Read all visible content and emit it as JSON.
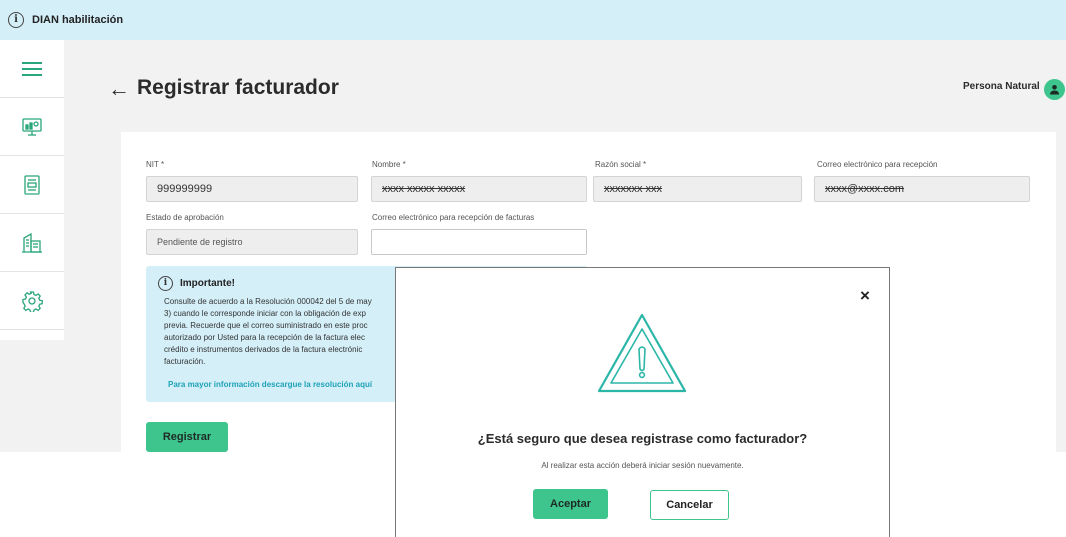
{
  "topbar": {
    "title": "DIAN habilitación",
    "icon": "info-icon"
  },
  "sidebar": {
    "items": [
      {
        "name": "menu-icon"
      },
      {
        "name": "computer-icon"
      },
      {
        "name": "document-icon"
      },
      {
        "name": "building-icon"
      },
      {
        "name": "gear-icon"
      }
    ]
  },
  "header": {
    "back_icon": "←",
    "title": "Registrar facturador",
    "user_type": "Persona Natural"
  },
  "form": {
    "nit": {
      "label": "NIT *",
      "value": "999999999"
    },
    "nombre": {
      "label": "Nombre *",
      "value": "xxxx xxxxx xxxxx"
    },
    "razon_social": {
      "label": "Razón social *",
      "value": "xxxxxxx xxx"
    },
    "correo_recepcion": {
      "label": "Correo electrónico para recepción",
      "value": "xxxx@xxxx.com"
    },
    "estado": {
      "label": "Estado de aprobación",
      "value": "Pendiente de registro"
    },
    "correo_facturas": {
      "label": "Correo electrónico para recepción de facturas",
      "value": ""
    }
  },
  "notice": {
    "title": "Importante!",
    "body": "Consulte de acuerdo a la Resolución 000042 del 5 de may\n3) cuando le corresponde iniciar con la obligación de exp\nprevia. Recuerde que el correo suministrado en este proc\nautorizado por Usted para la recepción de la factura elec\ncrédito e instrumentos derivados de la factura electrónic\nfacturación.",
    "link": "Para mayor información descargue la resolución aquí"
  },
  "register_button": "Registrar",
  "modal": {
    "question": "¿Está seguro que desea registrase como facturador?",
    "subtitle": "Al realizar esta acción deberá iniciar sesión nuevamente.",
    "accept": "Aceptar",
    "cancel": "Cancelar",
    "close_icon": "×",
    "warning_icon": "warning-icon"
  },
  "colors": {
    "accent": "#3ec58d",
    "banner": "#d4eff8",
    "link": "#1fa2b7",
    "warning": "#2bb6a8"
  }
}
